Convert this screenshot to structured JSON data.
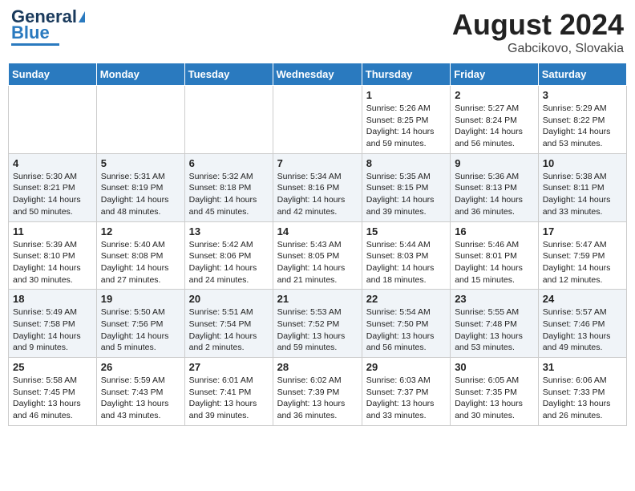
{
  "header": {
    "logo_line1": "General",
    "logo_line2": "Blue",
    "month_year": "August 2024",
    "location": "Gabcikovo, Slovakia"
  },
  "days_of_week": [
    "Sunday",
    "Monday",
    "Tuesday",
    "Wednesday",
    "Thursday",
    "Friday",
    "Saturday"
  ],
  "weeks": [
    [
      {
        "day": "",
        "info": ""
      },
      {
        "day": "",
        "info": ""
      },
      {
        "day": "",
        "info": ""
      },
      {
        "day": "",
        "info": ""
      },
      {
        "day": "1",
        "info": "Sunrise: 5:26 AM\nSunset: 8:25 PM\nDaylight: 14 hours\nand 59 minutes."
      },
      {
        "day": "2",
        "info": "Sunrise: 5:27 AM\nSunset: 8:24 PM\nDaylight: 14 hours\nand 56 minutes."
      },
      {
        "day": "3",
        "info": "Sunrise: 5:29 AM\nSunset: 8:22 PM\nDaylight: 14 hours\nand 53 minutes."
      }
    ],
    [
      {
        "day": "4",
        "info": "Sunrise: 5:30 AM\nSunset: 8:21 PM\nDaylight: 14 hours\nand 50 minutes."
      },
      {
        "day": "5",
        "info": "Sunrise: 5:31 AM\nSunset: 8:19 PM\nDaylight: 14 hours\nand 48 minutes."
      },
      {
        "day": "6",
        "info": "Sunrise: 5:32 AM\nSunset: 8:18 PM\nDaylight: 14 hours\nand 45 minutes."
      },
      {
        "day": "7",
        "info": "Sunrise: 5:34 AM\nSunset: 8:16 PM\nDaylight: 14 hours\nand 42 minutes."
      },
      {
        "day": "8",
        "info": "Sunrise: 5:35 AM\nSunset: 8:15 PM\nDaylight: 14 hours\nand 39 minutes."
      },
      {
        "day": "9",
        "info": "Sunrise: 5:36 AM\nSunset: 8:13 PM\nDaylight: 14 hours\nand 36 minutes."
      },
      {
        "day": "10",
        "info": "Sunrise: 5:38 AM\nSunset: 8:11 PM\nDaylight: 14 hours\nand 33 minutes."
      }
    ],
    [
      {
        "day": "11",
        "info": "Sunrise: 5:39 AM\nSunset: 8:10 PM\nDaylight: 14 hours\nand 30 minutes."
      },
      {
        "day": "12",
        "info": "Sunrise: 5:40 AM\nSunset: 8:08 PM\nDaylight: 14 hours\nand 27 minutes."
      },
      {
        "day": "13",
        "info": "Sunrise: 5:42 AM\nSunset: 8:06 PM\nDaylight: 14 hours\nand 24 minutes."
      },
      {
        "day": "14",
        "info": "Sunrise: 5:43 AM\nSunset: 8:05 PM\nDaylight: 14 hours\nand 21 minutes."
      },
      {
        "day": "15",
        "info": "Sunrise: 5:44 AM\nSunset: 8:03 PM\nDaylight: 14 hours\nand 18 minutes."
      },
      {
        "day": "16",
        "info": "Sunrise: 5:46 AM\nSunset: 8:01 PM\nDaylight: 14 hours\nand 15 minutes."
      },
      {
        "day": "17",
        "info": "Sunrise: 5:47 AM\nSunset: 7:59 PM\nDaylight: 14 hours\nand 12 minutes."
      }
    ],
    [
      {
        "day": "18",
        "info": "Sunrise: 5:49 AM\nSunset: 7:58 PM\nDaylight: 14 hours\nand 9 minutes."
      },
      {
        "day": "19",
        "info": "Sunrise: 5:50 AM\nSunset: 7:56 PM\nDaylight: 14 hours\nand 5 minutes."
      },
      {
        "day": "20",
        "info": "Sunrise: 5:51 AM\nSunset: 7:54 PM\nDaylight: 14 hours\nand 2 minutes."
      },
      {
        "day": "21",
        "info": "Sunrise: 5:53 AM\nSunset: 7:52 PM\nDaylight: 13 hours\nand 59 minutes."
      },
      {
        "day": "22",
        "info": "Sunrise: 5:54 AM\nSunset: 7:50 PM\nDaylight: 13 hours\nand 56 minutes."
      },
      {
        "day": "23",
        "info": "Sunrise: 5:55 AM\nSunset: 7:48 PM\nDaylight: 13 hours\nand 53 minutes."
      },
      {
        "day": "24",
        "info": "Sunrise: 5:57 AM\nSunset: 7:46 PM\nDaylight: 13 hours\nand 49 minutes."
      }
    ],
    [
      {
        "day": "25",
        "info": "Sunrise: 5:58 AM\nSunset: 7:45 PM\nDaylight: 13 hours\nand 46 minutes."
      },
      {
        "day": "26",
        "info": "Sunrise: 5:59 AM\nSunset: 7:43 PM\nDaylight: 13 hours\nand 43 minutes."
      },
      {
        "day": "27",
        "info": "Sunrise: 6:01 AM\nSunset: 7:41 PM\nDaylight: 13 hours\nand 39 minutes."
      },
      {
        "day": "28",
        "info": "Sunrise: 6:02 AM\nSunset: 7:39 PM\nDaylight: 13 hours\nand 36 minutes."
      },
      {
        "day": "29",
        "info": "Sunrise: 6:03 AM\nSunset: 7:37 PM\nDaylight: 13 hours\nand 33 minutes."
      },
      {
        "day": "30",
        "info": "Sunrise: 6:05 AM\nSunset: 7:35 PM\nDaylight: 13 hours\nand 30 minutes."
      },
      {
        "day": "31",
        "info": "Sunrise: 6:06 AM\nSunset: 7:33 PM\nDaylight: 13 hours\nand 26 minutes."
      }
    ]
  ]
}
